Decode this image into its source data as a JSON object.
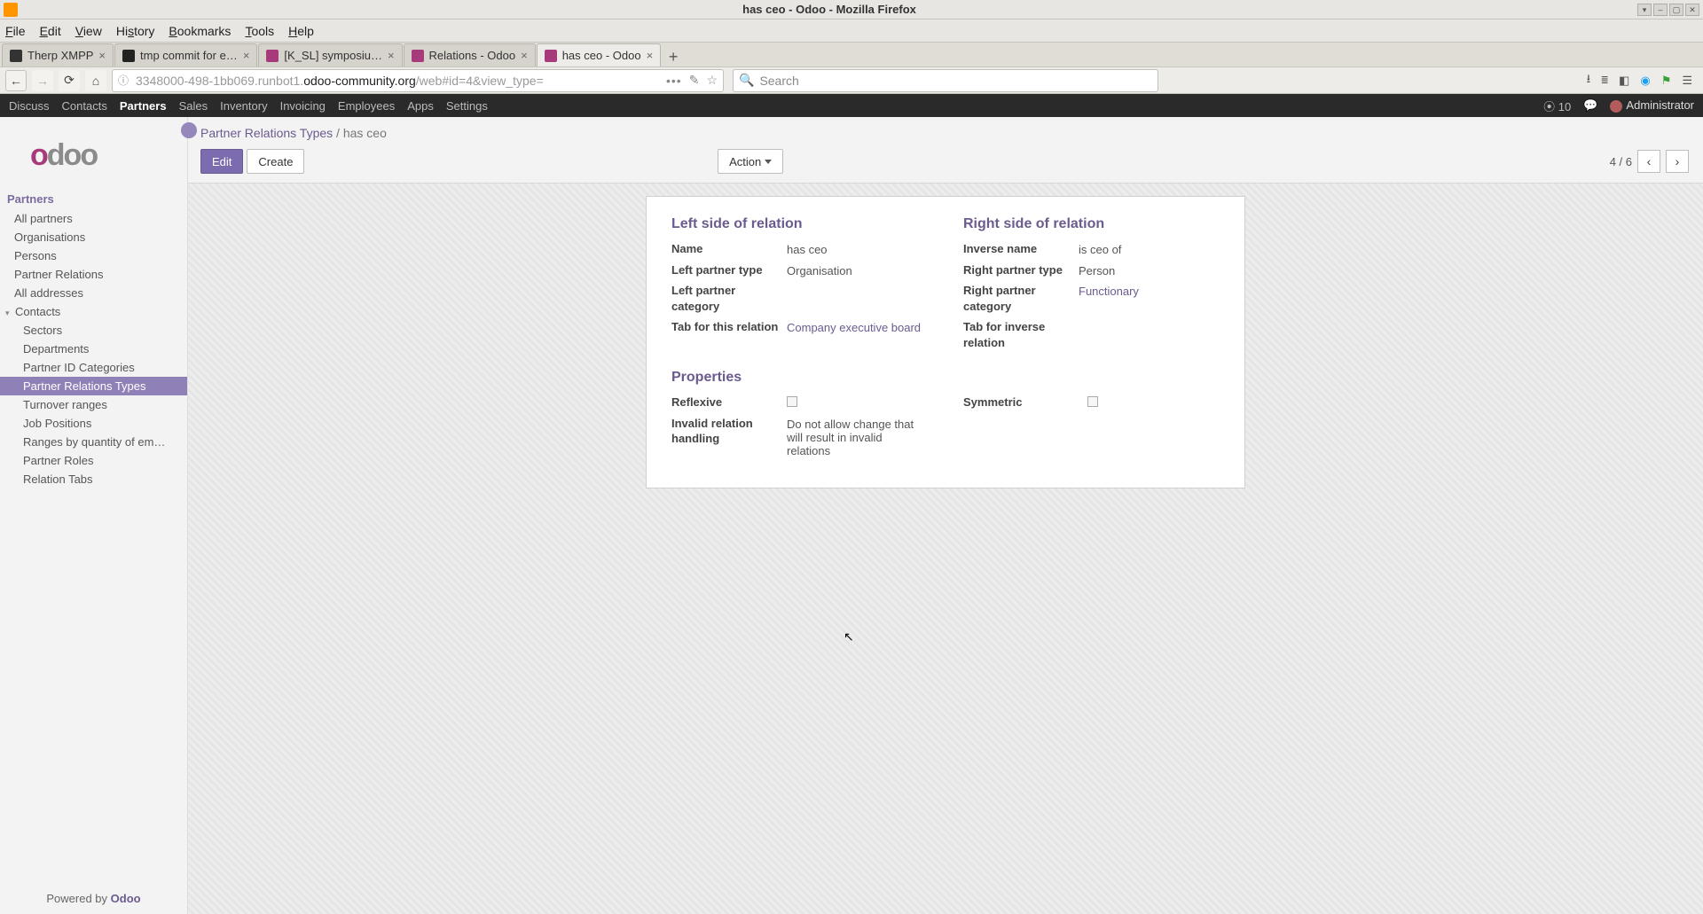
{
  "os": {
    "title": "has ceo - Odoo - Mozilla Firefox",
    "controls": {
      "min": "–",
      "max": "▢",
      "close": "✕",
      "down": "▾"
    }
  },
  "menubar": [
    "File",
    "Edit",
    "View",
    "History",
    "Bookmarks",
    "Tools",
    "Help"
  ],
  "browser_tabs": [
    {
      "label": "Therp XMPP",
      "fav": "#333",
      "active": false
    },
    {
      "label": "tmp commit for e…",
      "fav": "#222",
      "active": false
    },
    {
      "label": "[K_SL] symposiu…",
      "fav": "#a63a7a",
      "active": false
    },
    {
      "label": "Relations - Odoo",
      "fav": "#a63a7a",
      "active": false
    },
    {
      "label": "has ceo - Odoo",
      "fav": "#a63a7a",
      "active": true
    }
  ],
  "url": {
    "prefix": "3348000-498-1bb069.runbot1.",
    "host": "odoo-community.org",
    "suffix": "/web#id=4&view_type="
  },
  "search_placeholder": "Search",
  "odoo_nav": {
    "items": [
      "Discuss",
      "Contacts",
      "Partners",
      "Sales",
      "Inventory",
      "Invoicing",
      "Employees",
      "Apps",
      "Settings"
    ],
    "active": "Partners",
    "msg_count": "10",
    "user": "Administrator"
  },
  "sidebar": {
    "logo": "odoo",
    "header": "Partners",
    "items": [
      {
        "label": "All partners",
        "sub": false
      },
      {
        "label": "Organisations",
        "sub": false
      },
      {
        "label": "Persons",
        "sub": false
      },
      {
        "label": "Partner Relations",
        "sub": false
      },
      {
        "label": "All addresses",
        "sub": false
      }
    ],
    "contacts_label": "Contacts",
    "contacts_items": [
      {
        "label": "Sectors"
      },
      {
        "label": "Departments"
      },
      {
        "label": "Partner ID Categories"
      },
      {
        "label": "Partner Relations Types",
        "active": true
      },
      {
        "label": "Turnover ranges"
      },
      {
        "label": "Job Positions"
      },
      {
        "label": "Ranges by quantity of em…"
      },
      {
        "label": "Partner Roles"
      },
      {
        "label": "Relation Tabs"
      }
    ],
    "footer_prefix": "Powered by ",
    "footer_brand": "Odoo"
  },
  "control_panel": {
    "breadcrumb_root": "Partner Relations Types",
    "breadcrumb_leaf": "has ceo",
    "edit": "Edit",
    "create": "Create",
    "action": "Action",
    "pager": "4 / 6"
  },
  "form": {
    "left": {
      "title": "Left side of relation",
      "name_label": "Name",
      "name": "has ceo",
      "type_label": "Left partner type",
      "type": "Organisation",
      "cat_label": "Left partner category",
      "cat": "",
      "tab_label": "Tab for this relation",
      "tab": "Company executive board"
    },
    "right": {
      "title": "Right side of relation",
      "name_label": "Inverse name",
      "name": "is ceo of",
      "type_label": "Right partner type",
      "type": "Person",
      "cat_label": "Right partner category",
      "cat": "Functionary",
      "tab_label": "Tab for inverse relation",
      "tab": ""
    },
    "props": {
      "title": "Properties",
      "reflexive_label": "Reflexive",
      "symmetric_label": "Symmetric",
      "invalid_label": "Invalid relation handling",
      "invalid": "Do not allow change that will result in invalid relations"
    }
  }
}
